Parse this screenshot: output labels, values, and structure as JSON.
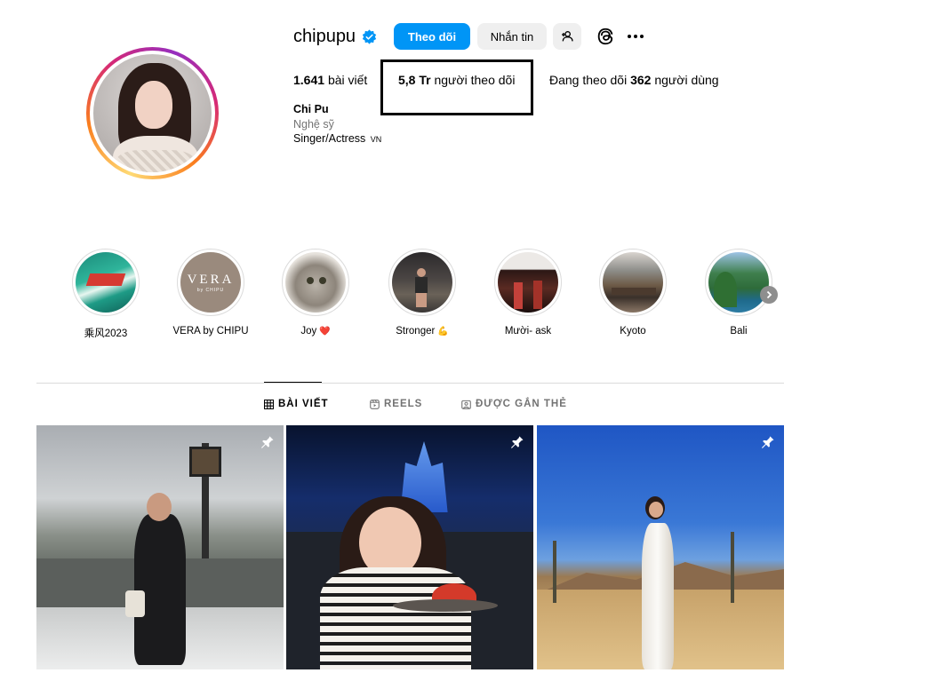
{
  "profile": {
    "username": "chipupu",
    "follow_label": "Theo dõi",
    "message_label": "Nhắn tin",
    "posts_count": "1.641",
    "posts_label": "bài viết",
    "followers_count": "5,8 Tr",
    "followers_label": "người theo dõi",
    "following_prefix": "Đang theo dõi",
    "following_count": "362",
    "following_suffix": "người dùng",
    "full_name": "Chi Pu",
    "category": "Nghệ sỹ",
    "bio": "Singer/Actress",
    "bio_flag": "VN"
  },
  "highlights": [
    {
      "label": "乘风2023",
      "emoji": ""
    },
    {
      "label": "VERA by CHIPU",
      "emoji": ""
    },
    {
      "label": "Joy",
      "emoji": "❤️"
    },
    {
      "label": "Stronger",
      "emoji": "💪"
    },
    {
      "label": "Mười- ask",
      "emoji": ""
    },
    {
      "label": "Kyoto",
      "emoji": ""
    },
    {
      "label": "Bali",
      "emoji": ""
    }
  ],
  "vera_logo": {
    "main": "VERA",
    "sub": "by CHIPU"
  },
  "tabs": {
    "posts": "BÀI VIẾT",
    "reels": "REELS",
    "tagged": "ĐƯỢC GẮN THẺ"
  },
  "colors": {
    "primary_button": "#0095f6",
    "secondary_button": "#efefef",
    "verified": "#0095f6",
    "muted_text": "#737373"
  },
  "icons": [
    "verified-badge-icon",
    "add-user-icon",
    "threads-icon",
    "more-icon",
    "grid-icon",
    "reels-icon",
    "tagged-icon",
    "pin-icon",
    "chevron-right-icon"
  ]
}
